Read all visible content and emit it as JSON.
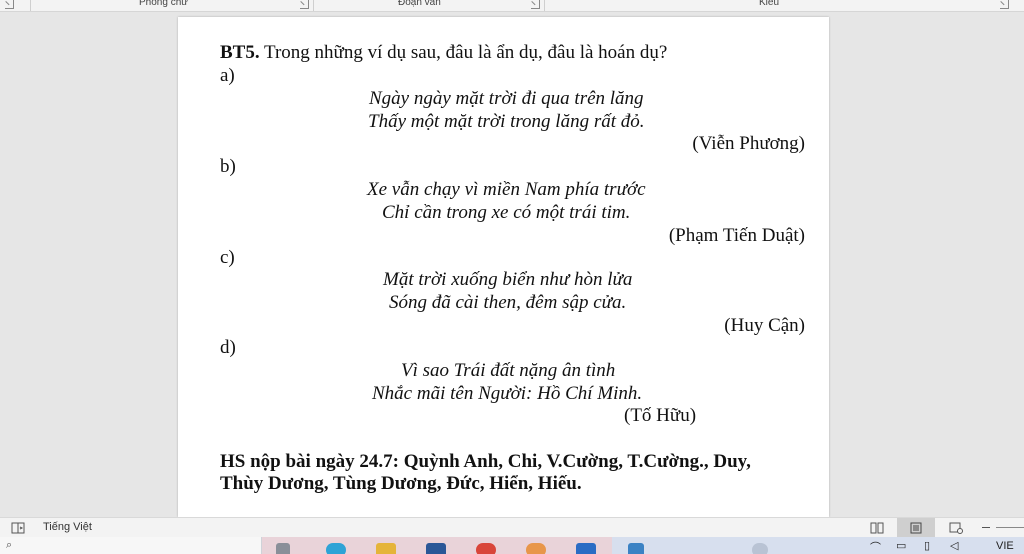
{
  "ribbon": {
    "groups": [
      "Phông chữ",
      "Đoạn văn",
      "Kiểu"
    ]
  },
  "document": {
    "heading_label": "BT5.",
    "heading_text": " Trong những ví dụ sau, đâu là ẩn dụ, đâu là hoán dụ?",
    "items": [
      {
        "label": "a)",
        "lines": [
          "Ngày ngày mặt trời đi qua trên lăng",
          "Thấy một mặt trời trong lăng rất đỏ."
        ],
        "author": "(Viễn Phương)"
      },
      {
        "label": "b)",
        "lines": [
          "Xe vẫn chạy vì miền Nam phía trước",
          "Chỉ cần trong xe có một trái tim."
        ],
        "author": "(Phạm Tiến Duật)"
      },
      {
        "label": "c)",
        "lines": [
          "Mặt trời xuống biển như hòn lửa",
          "Sóng đã cài then, đêm sập cửa."
        ],
        "author": "(Huy Cận)"
      },
      {
        "label": "d)",
        "lines": [
          "Vì sao Trái đất nặng ân tình",
          "Nhắc mãi tên Người: Hồ Chí Minh."
        ],
        "author": "(Tố Hữu)"
      }
    ],
    "footer_line1": "HS nộp bài ngày 24.7: Quỳnh Anh, Chi, V.Cường, T.Cường., Duy,",
    "footer_line2": "Thùy Dương, Tùng Dương,  Đức, Hiển, Hiếu."
  },
  "statusbar": {
    "language": "Tiếng Việt"
  },
  "taskbar": {
    "tray_lang": "VIE"
  },
  "colors": {
    "spell_underline": "#d23a3a",
    "grammar_underline": "#3a64d2",
    "page_bg": "#ffffff",
    "workspace_bg": "#e6e6e6"
  }
}
